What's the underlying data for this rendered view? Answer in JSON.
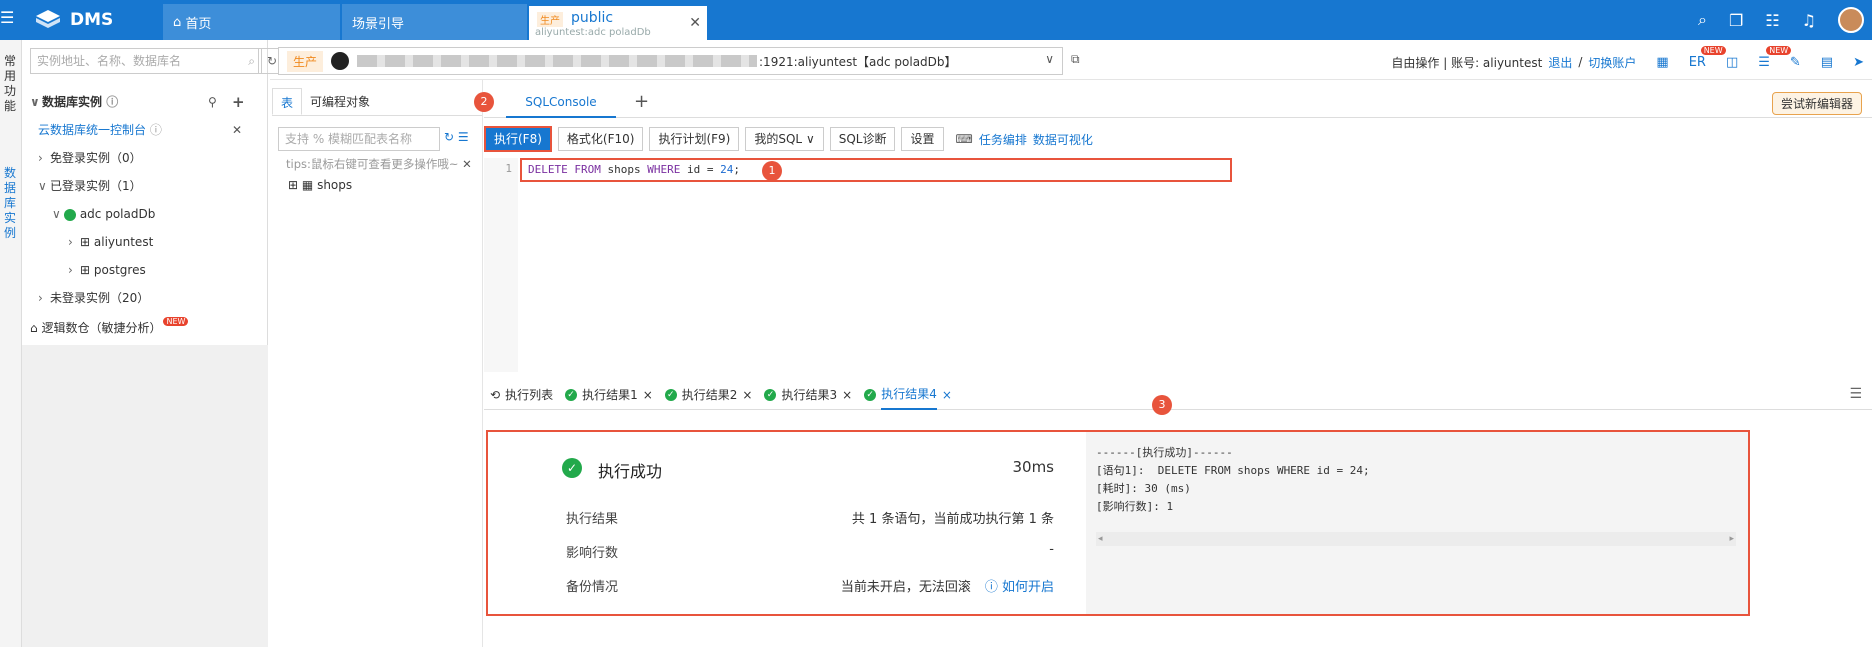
{
  "topbar": {
    "brand": "DMS",
    "tabs": [
      {
        "label": "首页"
      },
      {
        "label": "场景引导"
      },
      {
        "env": "生产",
        "label": "public",
        "sub": "aliyuntest:adc poladDb"
      }
    ]
  },
  "leftstrip": {
    "items": [
      "常用功能",
      "数据库实例"
    ]
  },
  "sidebar": {
    "search_placeholder": "实例地址、名称、数据库名",
    "section_title": "数据库实例",
    "console_link": "云数据库统一控制台",
    "tree": [
      {
        "label": "免登录实例（0）"
      },
      {
        "label": "已登录实例（1）"
      },
      {
        "label": "adc poladDb"
      },
      {
        "label": "aliyuntest"
      },
      {
        "label": "postgres"
      },
      {
        "label": "未登录实例（20）"
      }
    ],
    "logic_db": "逻辑数仓（敏捷分析）",
    "new_badge": "NEW"
  },
  "connection": {
    "env": "生产",
    "text": ":1921:aliyuntest【adc poladDb】",
    "mode": "自由操作 | 账号: aliyuntest",
    "logout": "退出",
    "sep": "/",
    "switch": "切换账户",
    "er": "ER",
    "new_badge": "NEW"
  },
  "left_tabs": {
    "table": "表",
    "programmable": "可编程对象",
    "search_placeholder": "支持 % 模糊匹配表名称",
    "tips": "tips:鼠标右键可查看更多操作哦~",
    "table_item": "shops"
  },
  "editor": {
    "tab": "SQLConsole",
    "try_new": "尝试新编辑器",
    "toolbar": {
      "run": "执行(F8)",
      "format": "格式化(F10)",
      "plan": "执行计划(F9)",
      "my_sql": "我的SQL",
      "diag": "SQL诊断",
      "settings": "设置",
      "task": "任务编排",
      "visual": "数据可视化"
    },
    "line_no": "1",
    "code": {
      "k1": "DELETE",
      "k2": "FROM",
      "t1": "shops",
      "k3": "WHERE",
      "t2": "id =",
      "n1": "24",
      "t3": ";"
    }
  },
  "markers": {
    "m1": "1",
    "m2": "2",
    "m3": "3"
  },
  "result_tabs": {
    "list": "执行列表",
    "r1": "执行结果1",
    "r2": "执行结果2",
    "r3": "执行结果3",
    "r4": "执行结果4",
    "close": "×"
  },
  "result": {
    "status": "执行成功",
    "time": "30ms",
    "rows": [
      {
        "label": "执行结果",
        "value": "共 1 条语句，当前成功执行第 1 条"
      },
      {
        "label": "影响行数",
        "value": "-"
      },
      {
        "label": "备份情况",
        "value": "当前未开启，无法回滚"
      }
    ],
    "how_to": "如何开启",
    "log": "------[执行成功]------\n[语句1]:  DELETE FROM shops WHERE id = 24;\n[耗时]: 30 (ms)\n[影响行数]: 1"
  }
}
